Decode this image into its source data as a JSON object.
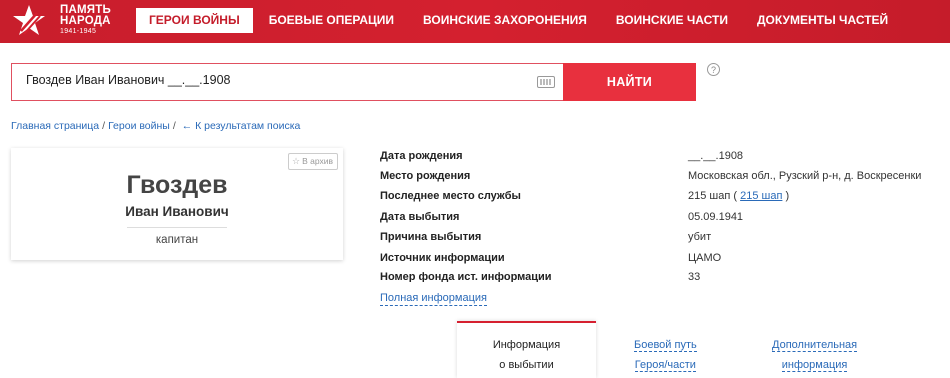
{
  "header": {
    "logo": {
      "line1": "ПАМЯТЬ",
      "line2": "НАРОДА",
      "years": "1941-1945"
    },
    "nav": [
      {
        "label": "ГЕРОИ ВОЙНЫ",
        "active": true
      },
      {
        "label": "БОЕВЫЕ ОПЕРАЦИИ",
        "active": false
      },
      {
        "label": "ВОИНСКИЕ ЗАХОРОНЕНИЯ",
        "active": false
      },
      {
        "label": "ВОИНСКИЕ ЧАСТИ",
        "active": false
      },
      {
        "label": "ДОКУМЕНТЫ ЧАСТЕЙ",
        "active": false
      }
    ],
    "colors": {
      "header_bg": "#d4202f",
      "accent": "#e8303e",
      "link": "#2a6ab8"
    }
  },
  "search": {
    "value": "Гвоздев Иван Иванович __.__.1908",
    "button_label": "НАЙТИ",
    "help_symbol": "?"
  },
  "breadcrumb": {
    "home": "Главная страница",
    "section": "Герои войны",
    "back": "← К результатам поиска",
    "separator": "/"
  },
  "card": {
    "archive_label": "В архив",
    "surname": "Гвоздев",
    "given_names": "Иван Иванович",
    "rank": "капитан"
  },
  "info": {
    "rows": [
      {
        "label": "Дата рождения",
        "value": "__.__.1908"
      },
      {
        "label": "Место рождения",
        "value": "Московская обл., Рузский р-н, д. Воскресенки"
      },
      {
        "label": "Последнее место службы",
        "value_prefix": "215 шап (",
        "value_link": "215 шап",
        "value_suffix": ")"
      },
      {
        "label": "Дата выбытия",
        "value": "05.09.1941"
      },
      {
        "label": "Причина выбытия",
        "value": "убит"
      },
      {
        "label": "Источник информации",
        "value": "ЦАМО"
      },
      {
        "label": "Номер фонда ист. информации",
        "value": "33"
      }
    ],
    "full_info_link": "Полная информация"
  },
  "tabs": [
    {
      "line1": "Информация",
      "line2": "о выбытии",
      "active": true
    },
    {
      "line1": "Боевой путь",
      "line2": "Героя/части",
      "active": false
    },
    {
      "line1": "Дополнительная",
      "line2": "информация",
      "active": false
    }
  ]
}
